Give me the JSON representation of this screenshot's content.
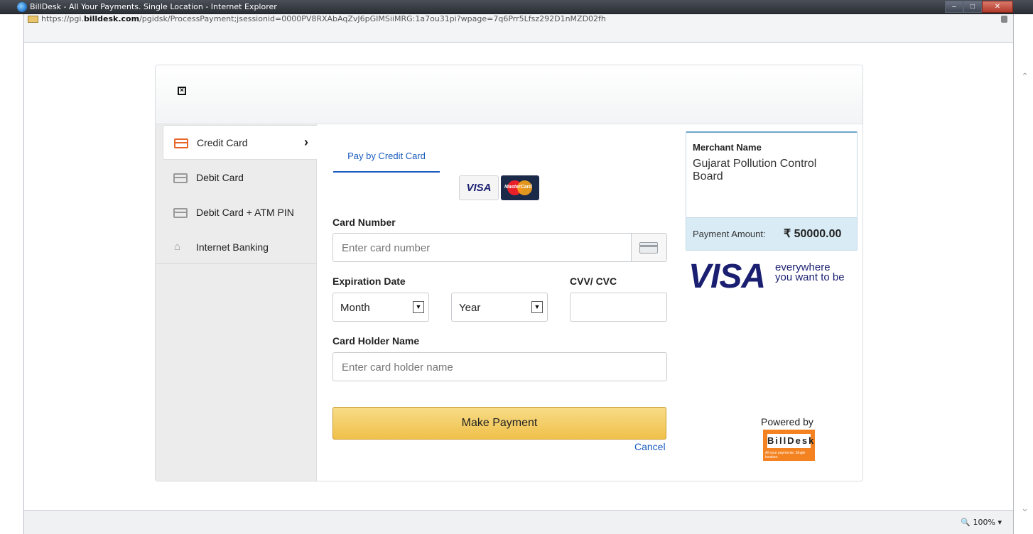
{
  "window": {
    "title": "BillDesk - All Your Payments. Single Location - Internet Explorer",
    "url_prefix": "https://pgi.",
    "url_domain": "billdesk.com",
    "url_path": "/pgidsk/ProcessPayment;jsessionid=0000PV8RXAbAqZvJ6pGIMSiiMRG:1a7ou31pi?wpage=7q6Prr5Lfsz292D1nMZD02fh",
    "zoom": "100%"
  },
  "sidebar": {
    "items": [
      {
        "label": "Credit Card",
        "icon": "credit-card-icon",
        "active": true
      },
      {
        "label": "Debit Card",
        "icon": "debit-card-icon"
      },
      {
        "label": "Debit Card + ATM PIN",
        "icon": "debit-card-icon"
      },
      {
        "label": "Internet Banking",
        "icon": "home-icon"
      }
    ]
  },
  "form": {
    "tab_label": "Pay by Credit Card",
    "visa_logo": "VISA",
    "mastercard_logo": "MasterCard",
    "card_number_label": "Card Number",
    "card_number_placeholder": "Enter card number",
    "expiration_label": "Expiration Date",
    "month_value": "Month",
    "year_value": "Year",
    "cvv_label": "CVV/ CVC",
    "holder_label": "Card Holder Name",
    "holder_placeholder": "Enter card holder name",
    "pay_button": "Make Payment",
    "cancel_link": "Cancel"
  },
  "merchant": {
    "heading": "Merchant Name",
    "name": "Gujarat Pollution Control Board",
    "amount_label": "Payment Amount:",
    "amount_value": "₹ 50000.00"
  },
  "branding": {
    "visa_text": "VISA",
    "visa_tagline_1": "everywhere",
    "visa_tagline_2": "you want to be",
    "powered_by": "Powered by",
    "billdesk_logo": "BillDesk",
    "billdesk_subtext": "All your payments. Single location."
  },
  "colors": {
    "accent_blue": "#1a5bbf",
    "button_gold": "#f0c04a",
    "active_icon_orange": "#e8652a",
    "billdesk_orange": "#f58220"
  }
}
